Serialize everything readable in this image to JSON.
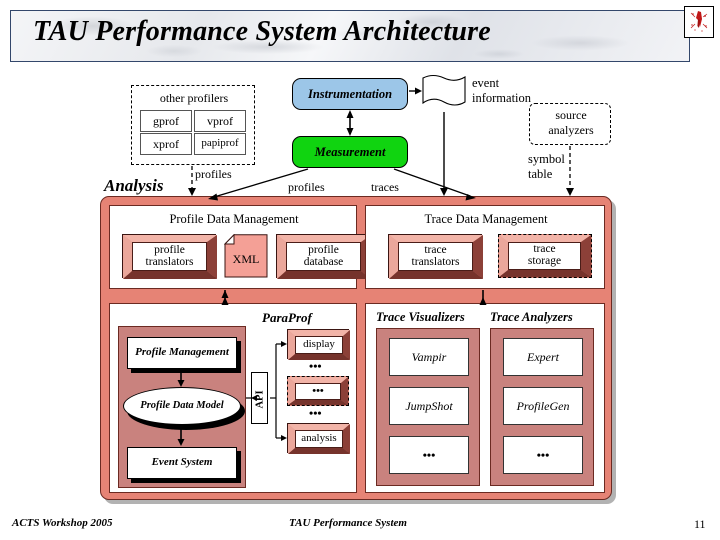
{
  "slide": {
    "title": "TAU Performance System Architecture",
    "logo_icon": "red-splatter-logo-icon"
  },
  "footer": {
    "left": "ACTS Workshop 2005",
    "center": "TAU Performance System",
    "page_number": "11"
  },
  "colors": {
    "frame": "#E68375",
    "panel_rose": "#C9827E",
    "instrumentation": "#9CC6E8",
    "measurement": "#10D410",
    "bevel_light": "#F0ADA1",
    "bevel_dark": "#8C4038",
    "title_border": "#33476B"
  },
  "top": {
    "other_profilers": {
      "title": "other profilers",
      "items": [
        "gprof",
        "vprof",
        "xprof",
        "papiprof"
      ]
    },
    "instrumentation": "Instrumentation",
    "measurement": "Measurement",
    "event_information": "event\ninformation",
    "event_information_line1": "event",
    "event_information_line2": "information",
    "source_analyzers_line1": "source",
    "source_analyzers_line2": "analyzers",
    "symbol_table_line1": "symbol",
    "symbol_table_line2": "table",
    "analysis_label": "Analysis",
    "edge_labels": {
      "profiles_left": "profiles",
      "profiles_mid": "profiles",
      "traces": "traces"
    }
  },
  "profile_data_management": {
    "title": "Profile Data Management",
    "profile_translators_line1": "profile",
    "profile_translators_line2": "translators",
    "xml": "XML",
    "profile_database_line1": "profile",
    "profile_database_line2": "database"
  },
  "trace_data_management": {
    "title": "Trace Data Management",
    "trace_translators_line1": "trace",
    "trace_translators_line2": "translators",
    "trace_storage_line1": "trace",
    "trace_storage_line2": "storage"
  },
  "paraprof": {
    "title": "ParaProf",
    "profile_management": "Profile Management",
    "profile_data_model": "Profile Data Model",
    "event_system": "Event System",
    "api": "API",
    "display": "display",
    "ellipsis_1": "•••",
    "ellipsis_mid_box": "•••",
    "ellipsis_2": "•••",
    "analysis": "analysis"
  },
  "trace_visualizers": {
    "title": "Trace Visualizers",
    "items": [
      "Vampir",
      "JumpShot",
      "•••"
    ]
  },
  "trace_analyzers": {
    "title": "Trace Analyzers",
    "items": [
      "Expert",
      "ProfileGen",
      "•••"
    ]
  }
}
